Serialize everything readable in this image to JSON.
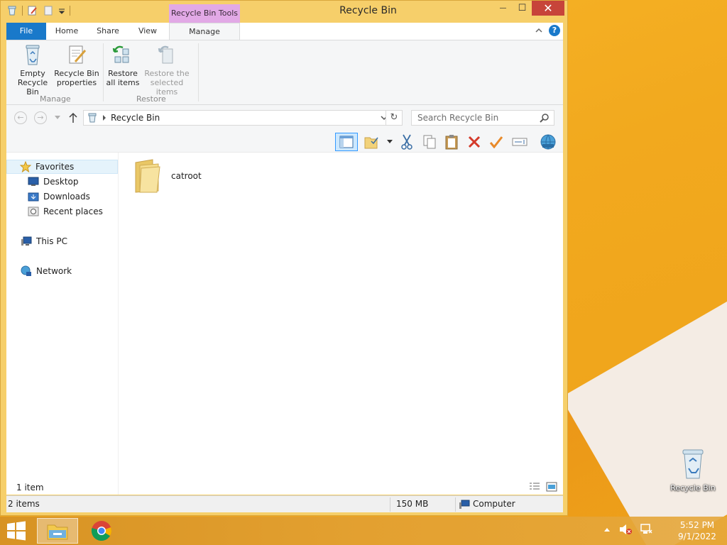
{
  "window": {
    "title": "Recycle Bin",
    "context_tab": "Recycle Bin Tools",
    "close_glyph": "✕",
    "minimize_glyph": "—",
    "maximize_glyph": "☐"
  },
  "tabs": {
    "file": "File",
    "home": "Home",
    "share": "Share",
    "view": "View",
    "manage": "Manage"
  },
  "ribbon": {
    "empty_l1": "Empty",
    "empty_l2": "Recycle Bin",
    "props_l1": "Recycle Bin",
    "props_l2": "properties",
    "restore_all_l1": "Restore",
    "restore_all_l2": "all items",
    "restore_sel_l1": "Restore the",
    "restore_sel_l2": "selected items",
    "group_manage": "Manage",
    "group_restore": "Restore"
  },
  "address": {
    "path": "Recycle Bin",
    "search_placeholder": "Search Recycle Bin"
  },
  "nav": {
    "favorites": "Favorites",
    "desktop": "Desktop",
    "downloads": "Downloads",
    "recent": "Recent places",
    "this_pc": "This PC",
    "network": "Network"
  },
  "files": [
    {
      "name": "catroot",
      "type": "folder"
    }
  ],
  "content_status": "1 item",
  "statusbar": {
    "items": "2 items",
    "size": "150 MB",
    "zone": "Computer"
  },
  "desktop": {
    "recycle_label": "Recycle Bin"
  },
  "clock": {
    "time": "5:52 PM",
    "date": "9/1/2022"
  },
  "colors": {
    "accent": "#1979ca",
    "context_tab": "#e2a9e6",
    "close": "#c7443a",
    "window_frame": "#f6cf6a"
  }
}
